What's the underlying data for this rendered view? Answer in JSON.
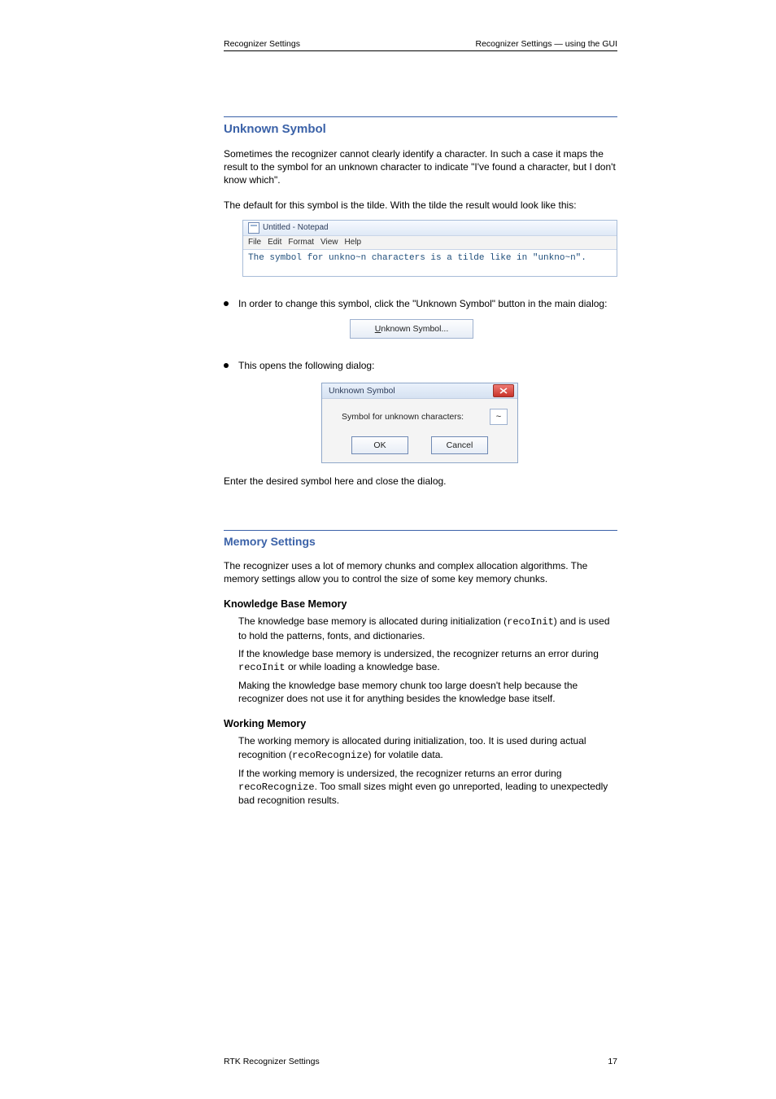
{
  "header": {
    "left": "Recognizer Settings",
    "right": "Recognizer Settings — using the GUI"
  },
  "section1": {
    "title": "Unknown Symbol",
    "intro1": "Sometimes the recognizer cannot clearly identify a character. In such a case it maps the result to the symbol for an unknown character to indicate \"I've found a character, but I don't know which\".",
    "intro2": "The default for this symbol is the tilde. With the tilde the result would look like this:",
    "notepad": {
      "title": "Untitled - Notepad",
      "menus": [
        "File",
        "Edit",
        "Format",
        "View",
        "Help"
      ],
      "body": "The symbol for unkno~n characters is a tilde like in \"unkno~n\"."
    },
    "bullet1": "In order to change this symbol, click the \"Unknown Symbol\" button in the main dialog:",
    "button_label_u": "U",
    "button_label_rest": "nknown Symbol...",
    "bullet2": "This opens the following dialog:",
    "dialog": {
      "title": "Unknown Symbol",
      "label": "Symbol for unknown characters:",
      "value": "~",
      "ok": "OK",
      "cancel": "Cancel"
    },
    "after_dialog": "Enter the desired symbol here and close the dialog."
  },
  "section2": {
    "title": "Memory Settings",
    "intro": "The recognizer uses a lot of memory chunks and complex allocation algorithms. The memory settings allow you to control the size of some key memory chunks.",
    "sub1_title": "Knowledge Base Memory",
    "sub1_p1": "The knowledge base memory is allocated during initialization (",
    "sub1_p1_code": "recoInit",
    "sub1_p1_after": ") and is used to hold the patterns, fonts, and dictionaries.",
    "sub1_p2": "If the knowledge base memory is undersized, the recognizer returns an error during ",
    "sub1_p2_code": "recoInit",
    "sub1_p2_after": " or while loading a knowledge base.",
    "sub1_p3": "Making the knowledge base memory chunk too large doesn't help because the recognizer does not use it for anything besides the knowledge base itself.",
    "sub2_title": "Working Memory",
    "sub2_p1": "The working memory is allocated during initialization, too. It is used during actual recognition (",
    "sub2_p1_code": "recoRecognize",
    "sub2_p1_after": ") for volatile data.",
    "sub2_p2": "If the working memory is undersized, the recognizer returns an error during ",
    "sub2_p2_code": "recoRecognize",
    "sub2_p2_after": ". Too small sizes might even go unreported, leading to unexpectedly bad recognition results."
  },
  "footer": {
    "left": "RTK Recognizer Settings",
    "right": "17"
  }
}
